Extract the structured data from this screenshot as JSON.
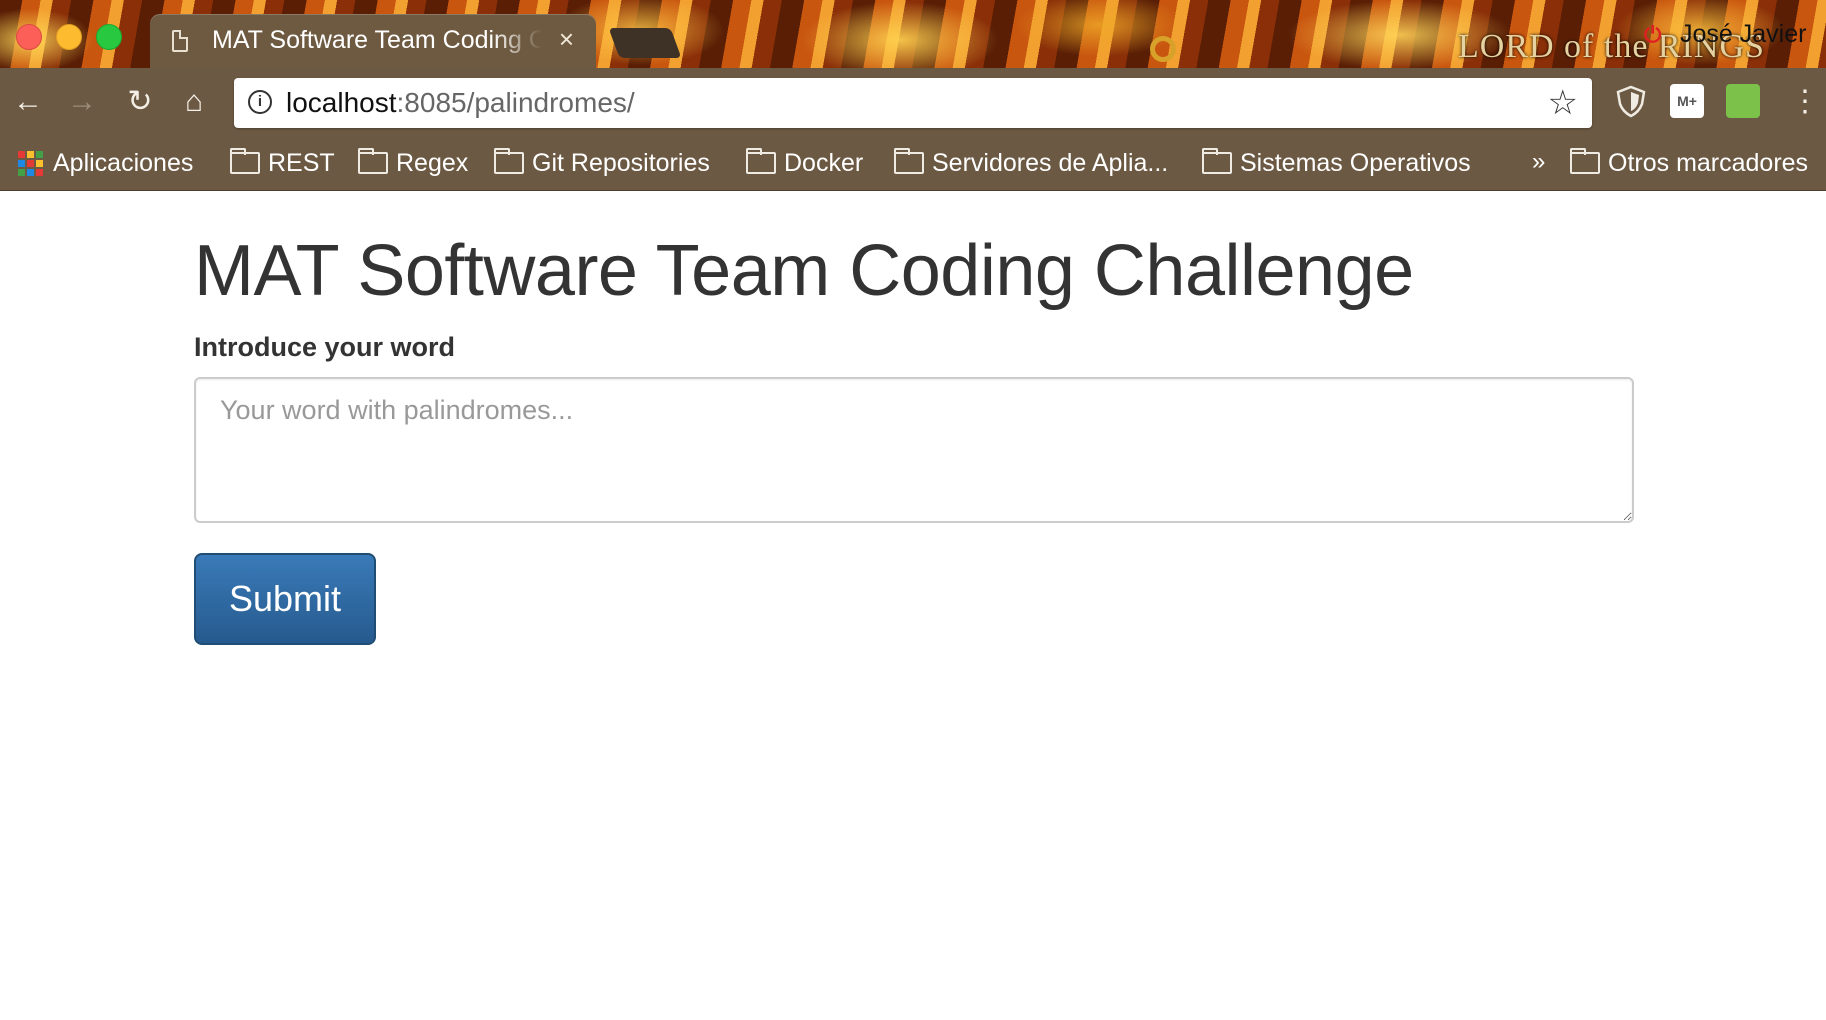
{
  "browser": {
    "tab_title": "MAT Software Team Coding Challenge",
    "tab_close": "×",
    "profile_name": "José Javier",
    "theme_logo": "LORD of the RINGS",
    "url_host": "localhost",
    "url_rest": ":8085/palindromes/",
    "nav": {
      "back": "←",
      "forward": "→",
      "reload": "↻",
      "home": "⌂"
    },
    "star": "☆",
    "menu": "⋮",
    "ext_mplus": "M+",
    "bookmarks": {
      "apps": "Aplicaciones",
      "items": [
        "REST",
        "Regex",
        "Git Repositories",
        "Docker",
        "Servidores de Aplia...",
        "Sistemas Operativos"
      ],
      "overflow": "»",
      "other": "Otros marcadores"
    },
    "icons": {
      "tab": "page-icon",
      "info": "info-icon",
      "star": "star-icon",
      "shield": "shield-extension-icon",
      "mplus": "m-plus-extension-icon",
      "leaf": "leaf-extension-icon",
      "folder": "folder-icon",
      "apps": "apps-grid-icon"
    }
  },
  "page": {
    "title": "MAT Software Team Coding Challenge",
    "label": "Introduce your word",
    "textarea_placeholder": "Your word with palindromes...",
    "textarea_value": "",
    "submit_label": "Submit"
  },
  "colors": {
    "primary_button": "#2e6da4",
    "chrome_toolbar": "#6c5943"
  }
}
